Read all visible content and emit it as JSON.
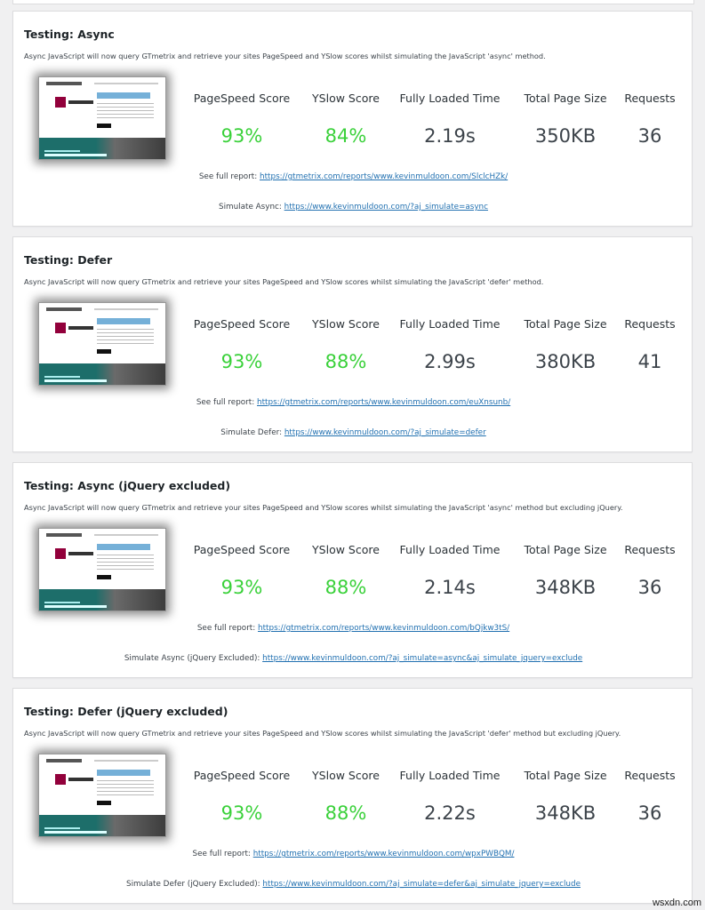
{
  "tests": [
    {
      "title": "Testing: Async",
      "description": "Async JavaScript will now query GTmetrix and retrieve your sites PageSpeed and YSlow scores whilst simulating the JavaScript 'async' method.",
      "stats": [
        {
          "label": "PageSpeed Score",
          "value": "93%"
        },
        {
          "label": "YSlow Score",
          "value": "84%"
        },
        {
          "label": "Fully Loaded Time",
          "value": "2.19s"
        },
        {
          "label": "Total Page Size",
          "value": "350KB"
        },
        {
          "label": "Requests",
          "value": "36"
        }
      ],
      "report_label": "See full report:",
      "report_url": "https://gtmetrix.com/reports/www.kevinmuldoon.com/SlclcHZk/",
      "simulate_label": "Simulate Async:",
      "simulate_url": "https://www.kevinmuldoon.com/?aj_simulate=async"
    },
    {
      "title": "Testing: Defer",
      "description": "Async JavaScript will now query GTmetrix and retrieve your sites PageSpeed and YSlow scores whilst simulating the JavaScript 'defer' method.",
      "stats": [
        {
          "label": "PageSpeed Score",
          "value": "93%"
        },
        {
          "label": "YSlow Score",
          "value": "88%"
        },
        {
          "label": "Fully Loaded Time",
          "value": "2.99s"
        },
        {
          "label": "Total Page Size",
          "value": "380KB"
        },
        {
          "label": "Requests",
          "value": "41"
        }
      ],
      "report_label": "See full report:",
      "report_url": "https://gtmetrix.com/reports/www.kevinmuldoon.com/euXnsunb/",
      "simulate_label": "Simulate Defer:",
      "simulate_url": "https://www.kevinmuldoon.com/?aj_simulate=defer"
    },
    {
      "title": "Testing: Async (jQuery excluded)",
      "description": "Async JavaScript will now query GTmetrix and retrieve your sites PageSpeed and YSlow scores whilst simulating the JavaScript 'async' method but excluding jQuery.",
      "stats": [
        {
          "label": "PageSpeed Score",
          "value": "93%"
        },
        {
          "label": "YSlow Score",
          "value": "88%"
        },
        {
          "label": "Fully Loaded Time",
          "value": "2.14s"
        },
        {
          "label": "Total Page Size",
          "value": "348KB"
        },
        {
          "label": "Requests",
          "value": "36"
        }
      ],
      "report_label": "See full report:",
      "report_url": "https://gtmetrix.com/reports/www.kevinmuldoon.com/bQjkw3tS/",
      "simulate_label": "Simulate Async (jQuery Excluded):",
      "simulate_url": "https://www.kevinmuldoon.com/?aj_simulate=async&aj_simulate_jquery=exclude"
    },
    {
      "title": "Testing: Defer (jQuery excluded)",
      "description": "Async JavaScript will now query GTmetrix and retrieve your sites PageSpeed and YSlow scores whilst simulating the JavaScript 'defer' method but excluding jQuery.",
      "stats": [
        {
          "label": "PageSpeed Score",
          "value": "93%"
        },
        {
          "label": "YSlow Score",
          "value": "88%"
        },
        {
          "label": "Fully Loaded Time",
          "value": "2.22s"
        },
        {
          "label": "Total Page Size",
          "value": "348KB"
        },
        {
          "label": "Requests",
          "value": "36"
        }
      ],
      "report_label": "See full report:",
      "report_url": "https://gtmetrix.com/reports/www.kevinmuldoon.com/wpxPWBQM/",
      "simulate_label": "Simulate Defer (jQuery Excluded):",
      "simulate_url": "https://www.kevinmuldoon.com/?aj_simulate=defer&aj_simulate_jquery=exclude"
    }
  ],
  "colors": {
    "score_good": "#3ad13a",
    "link": "#2271b1"
  },
  "watermark": "wsxdn.com"
}
